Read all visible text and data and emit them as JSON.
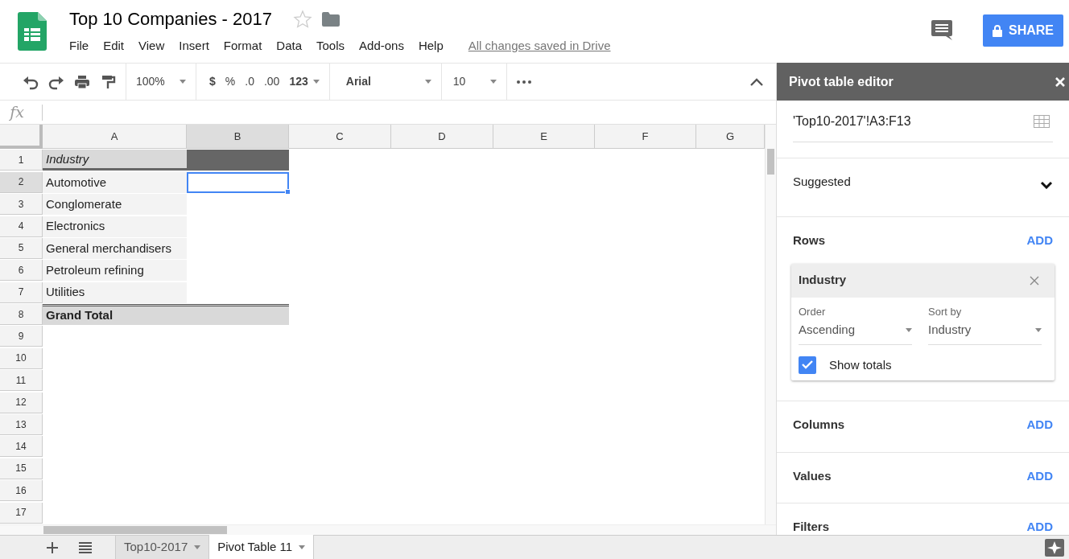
{
  "app": {
    "title": "Top 10 Companies - 2017",
    "starred": false,
    "menu": [
      "File",
      "Edit",
      "View",
      "Insert",
      "Format",
      "Data",
      "Tools",
      "Add-ons",
      "Help"
    ],
    "save_status": "All changes saved in Drive",
    "share_button": "SHARE"
  },
  "toolbar": {
    "zoom": "100%",
    "currency": "$",
    "percent": "%",
    "decrease_decimals": ".0",
    "increase_decimals": ".00",
    "more_formats": "123",
    "font": "Arial",
    "font_size": "10"
  },
  "formula_bar": {
    "label": "fx"
  },
  "sheet": {
    "columns": [
      {
        "label": "A",
        "selected": false
      },
      {
        "label": "B",
        "selected": true
      },
      {
        "label": "C",
        "selected": false
      },
      {
        "label": "D",
        "selected": false
      },
      {
        "label": "E",
        "selected": false
      },
      {
        "label": "F",
        "selected": false
      },
      {
        "label": "G",
        "selected": false
      }
    ],
    "rows": [
      {
        "label": "1",
        "selected": false,
        "kind": "header",
        "value": "Industry"
      },
      {
        "label": "2",
        "selected": true,
        "kind": "item",
        "value": "Automotive"
      },
      {
        "label": "3",
        "selected": false,
        "kind": "item",
        "value": "Conglomerate"
      },
      {
        "label": "4",
        "selected": false,
        "kind": "item",
        "value": "Electronics"
      },
      {
        "label": "5",
        "selected": false,
        "kind": "item",
        "value": "General merchandisers"
      },
      {
        "label": "6",
        "selected": false,
        "kind": "item",
        "value": "Petroleum refining"
      },
      {
        "label": "7",
        "selected": false,
        "kind": "item",
        "value": "Utilities"
      },
      {
        "label": "8",
        "selected": false,
        "kind": "total",
        "value": "Grand Total"
      },
      {
        "label": "9",
        "selected": false,
        "kind": "empty"
      },
      {
        "label": "10",
        "selected": false,
        "kind": "empty"
      },
      {
        "label": "11",
        "selected": false,
        "kind": "empty"
      },
      {
        "label": "12",
        "selected": false,
        "kind": "empty"
      },
      {
        "label": "13",
        "selected": false,
        "kind": "empty"
      },
      {
        "label": "14",
        "selected": false,
        "kind": "empty"
      },
      {
        "label": "15",
        "selected": false,
        "kind": "empty"
      },
      {
        "label": "16",
        "selected": false,
        "kind": "empty"
      },
      {
        "label": "17",
        "selected": false,
        "kind": "empty"
      }
    ]
  },
  "sheet_tabs": [
    {
      "label": "Top10-2017",
      "selected": false
    },
    {
      "label": "Pivot Table 11",
      "selected": true
    }
  ],
  "pivot_editor": {
    "title": "Pivot table editor",
    "range": "'Top10-2017'!A3:F13",
    "suggested": {
      "label": "Suggested",
      "expanded": false
    },
    "sections": [
      {
        "label": "Rows",
        "action": "ADD",
        "fields": [
          {
            "name": "Industry",
            "order_label": "Order",
            "order": "Ascending",
            "sort_label": "Sort by",
            "sort_by": "Industry",
            "show_totals_label": "Show totals",
            "show_totals": true
          }
        ]
      },
      {
        "label": "Columns",
        "action": "ADD"
      },
      {
        "label": "Values",
        "action": "ADD"
      },
      {
        "label": "Filters",
        "action": "ADD"
      }
    ]
  }
}
